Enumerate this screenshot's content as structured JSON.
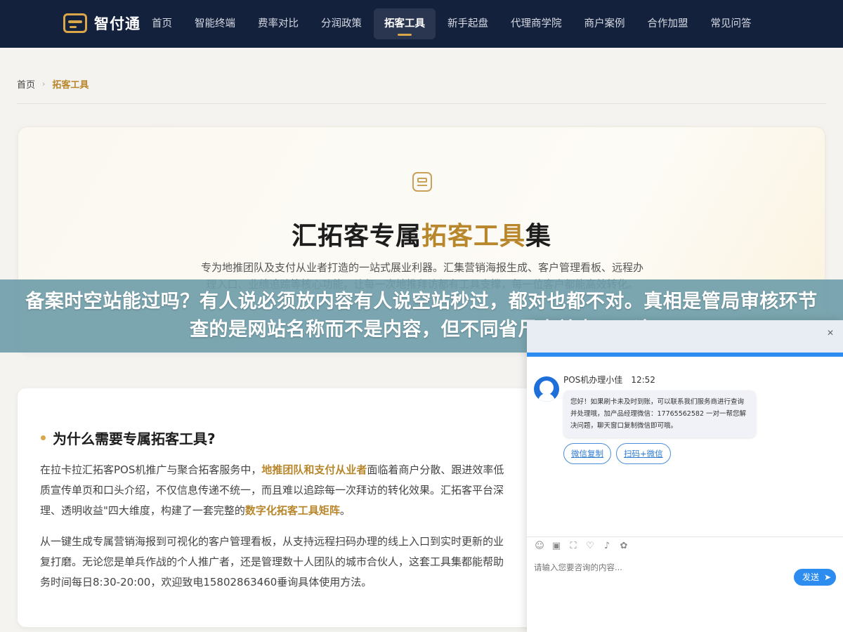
{
  "nav": {
    "logo_text": "智付通",
    "items": [
      {
        "label": "首页"
      },
      {
        "label": "智能终端"
      },
      {
        "label": "费率对比"
      },
      {
        "label": "分润政策"
      },
      {
        "label": "拓客工具",
        "active": true
      },
      {
        "label": "新手起盘"
      },
      {
        "label": "代理商学院"
      },
      {
        "label": "商户案例"
      },
      {
        "label": "合作加盟"
      },
      {
        "label": "常见问答"
      }
    ]
  },
  "breadcrumb": {
    "home": "首页",
    "separator": "›",
    "current": "拓客工具"
  },
  "hero": {
    "title_prefix": "汇拓客专属",
    "title_highlight": "拓客工具",
    "title_suffix": "集",
    "description": "专为地推团队及支付从业者打造的一站式展业利器。汇集营销海报生成、客户管理看板、远程办理入口、业绩追踪等核心功能，让每一次地推拜访都有工具支撑，每一位客户都能高效转化。"
  },
  "article": {
    "title": "为什么需要专属拓客工具?",
    "p1_a": "在拉卡拉汇拓客POS机推广与聚合拓客服务中，",
    "p1_hl": "地推团队和支付从业者",
    "p1_b": "面临着商户分散、跟进效率低",
    "p1_line2": "质宣传单页和口头介绍，不仅信息传递不统一，而且难以追踪每一次拜访的转化效果。汇拓客平台深",
    "p1_c": "理、透明收益\"四大维度，构建了一套完整的",
    "p1_hl2": "数字化拓客工具矩阵",
    "p1_d": "。",
    "p2_line1": "从一键生成专属营销海报到可视化的客户管理看板，从支持远程扫码办理的线上入口到实时更新的业",
    "p2_line2": "复打磨。无论您是单兵作战的个人推广者，还是管理数十人团队的城市合伙人，这套工具集都能帮助",
    "p2_line3": "务时间每日8:30-20:00，欢迎致电15802863460垂询具体使用方法。"
  },
  "banner": {
    "text": "备案时空站能过吗？有人说必须放内容有人说空站秒过，都对也都不对。真相是管局审核环节查的是网站名称而不是内容，但不同省尺度差太远，这"
  },
  "chat": {
    "close": "✕",
    "agent_name": "POS机办理小佳",
    "time": "12:52",
    "message": "您好！如果刷卡未及时到账，可以联系我们服务商进行查询并处理哦，加产品经理微信：17765562582 一对一帮您解决问题，聊天窗口复制微信即可哦。",
    "quick_buttons": [
      "微信复制",
      "扫码+微信"
    ],
    "input_placeholder": "请输入您要咨询的内容...",
    "send_label": "发送",
    "send_icon": "➤",
    "tools": [
      "☺",
      "▣",
      "⛶",
      "♡",
      "♪",
      "✿"
    ]
  }
}
